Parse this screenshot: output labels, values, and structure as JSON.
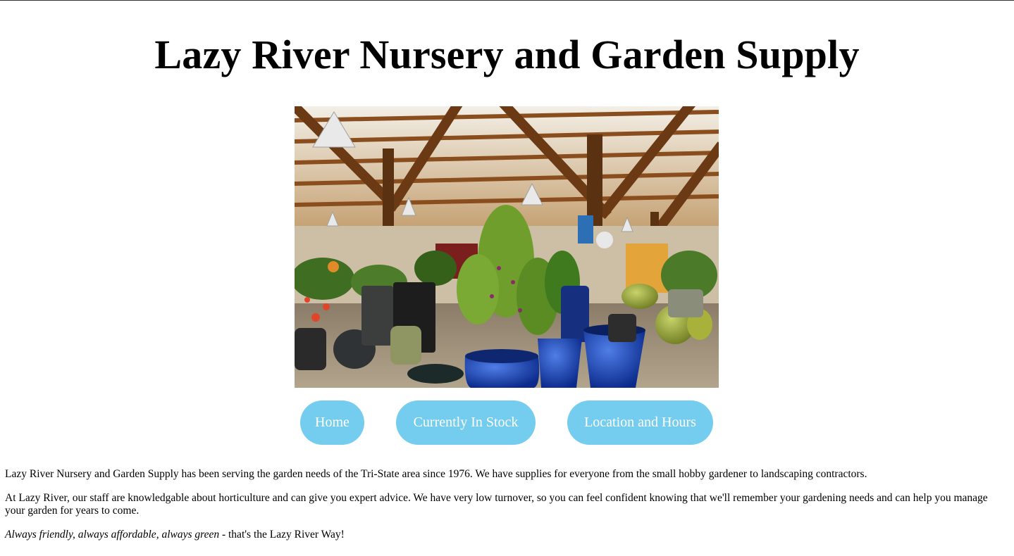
{
  "page": {
    "title": "Lazy River Nursery and Garden Supply"
  },
  "hero": {
    "icon": "garden-center-photo"
  },
  "nav": {
    "items": [
      {
        "label": "Home"
      },
      {
        "label": "Currently In Stock"
      },
      {
        "label": "Location and Hours"
      }
    ],
    "button_color": "#74cdee",
    "text_color": "#ffffff"
  },
  "content": {
    "paragraph1": "Lazy River Nursery and Garden Supply has been serving the garden needs of the Tri-State area since 1976. We have supplies for everyone from the small hobby gardener to landscaping contractors.",
    "paragraph2": "At Lazy River, our staff are knowledgable about horticulture and can give you expert advice. We have very low turnover, so you can feel confident knowing that we'll remember your gardening needs and can help you manage your garden for years to come.",
    "tagline_emphasis": "Always friendly, always affordable, always green",
    "tagline_rest": " - that's the Lazy River Way!"
  }
}
